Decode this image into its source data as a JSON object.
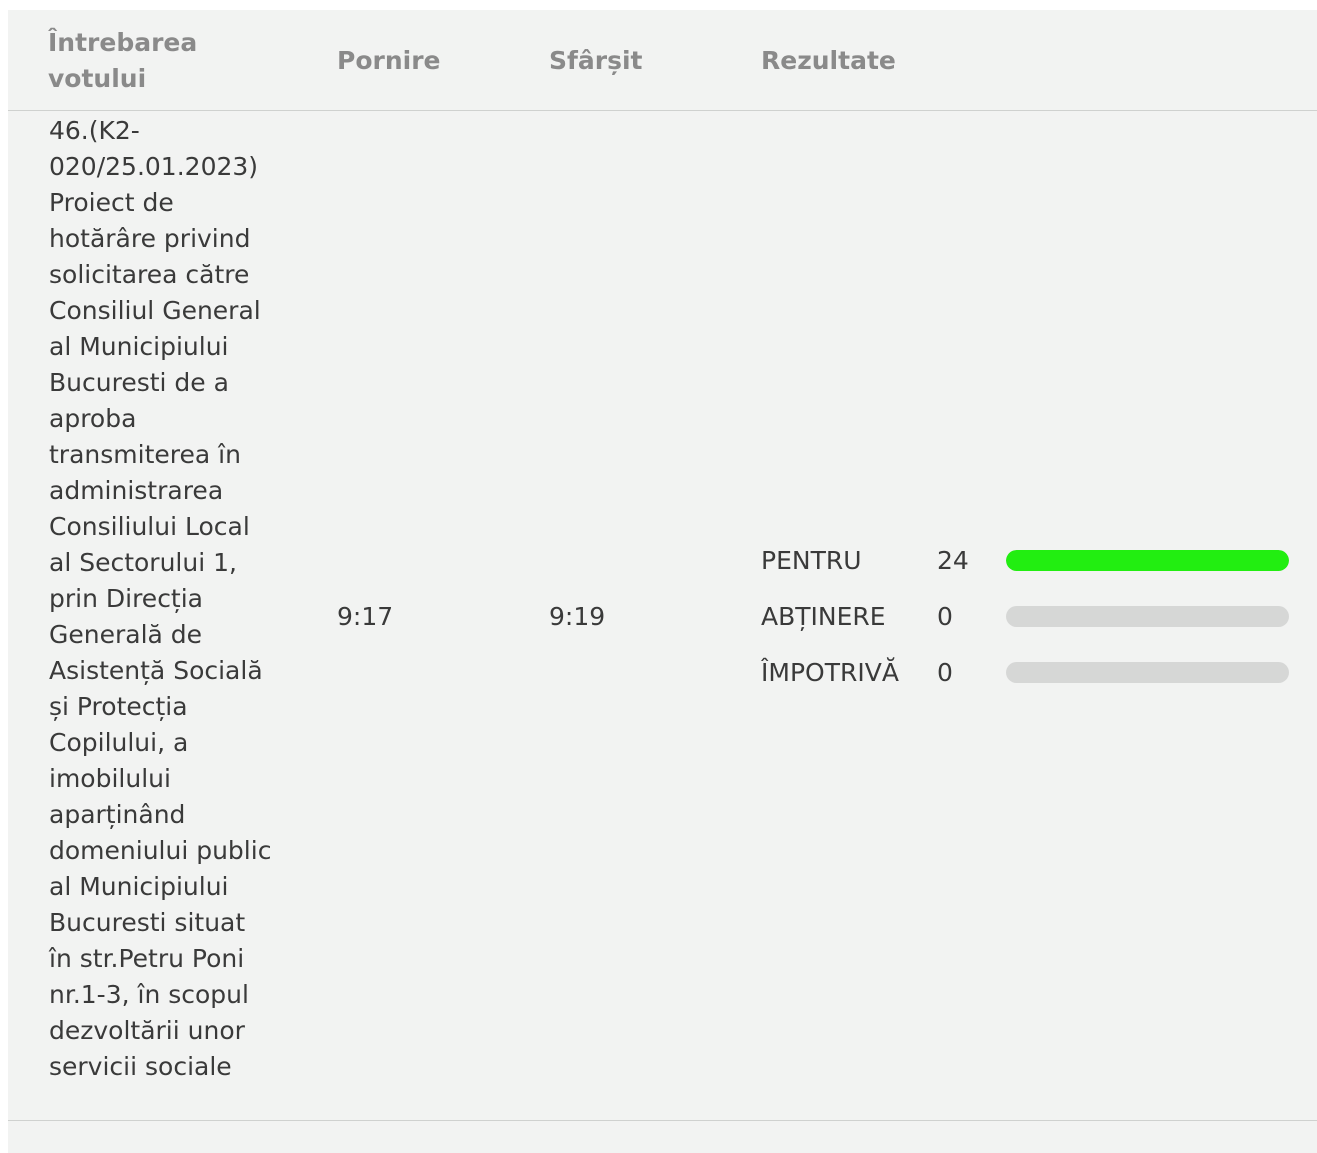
{
  "table": {
    "headers": {
      "question": "Întrebarea votului",
      "start": "Pornire",
      "end": "Sfârșit",
      "results": "Rezultate"
    },
    "rows": [
      {
        "question": "46.(K2-020/25.01.2023) Proiect de hotărâre privind solicitarea către Consiliul General al Municipiului Bucuresti de a aproba transmiterea în administrarea Consiliului Local al Sectorului 1, prin Direcția Generală de Asistență Socială și Protecția Copilului, a imobilului aparținând domeniului public al Municipiului Bucuresti situat în str.Petru Poni nr.1-3, în scopul dezvoltării unor servicii sociale",
        "start": "9:17",
        "end": "9:19",
        "results": [
          {
            "label": "PENTRU",
            "count": "24",
            "fill_fraction": 1.0,
            "color": "#22ee11"
          },
          {
            "label": "ABȚINERE",
            "count": "0",
            "fill_fraction": 0.0,
            "color": "#22ee11"
          },
          {
            "label": "ÎMPOTRIVĂ",
            "count": "0",
            "fill_fraction": 0.0,
            "color": "#22ee11"
          }
        ]
      }
    ]
  },
  "colors": {
    "panel_background": "#f2f3f2",
    "header_text": "#8a8a8a",
    "body_text": "#3a3a3a",
    "bar_track": "#d6d7d6",
    "bar_for": "#22ee11"
  }
}
